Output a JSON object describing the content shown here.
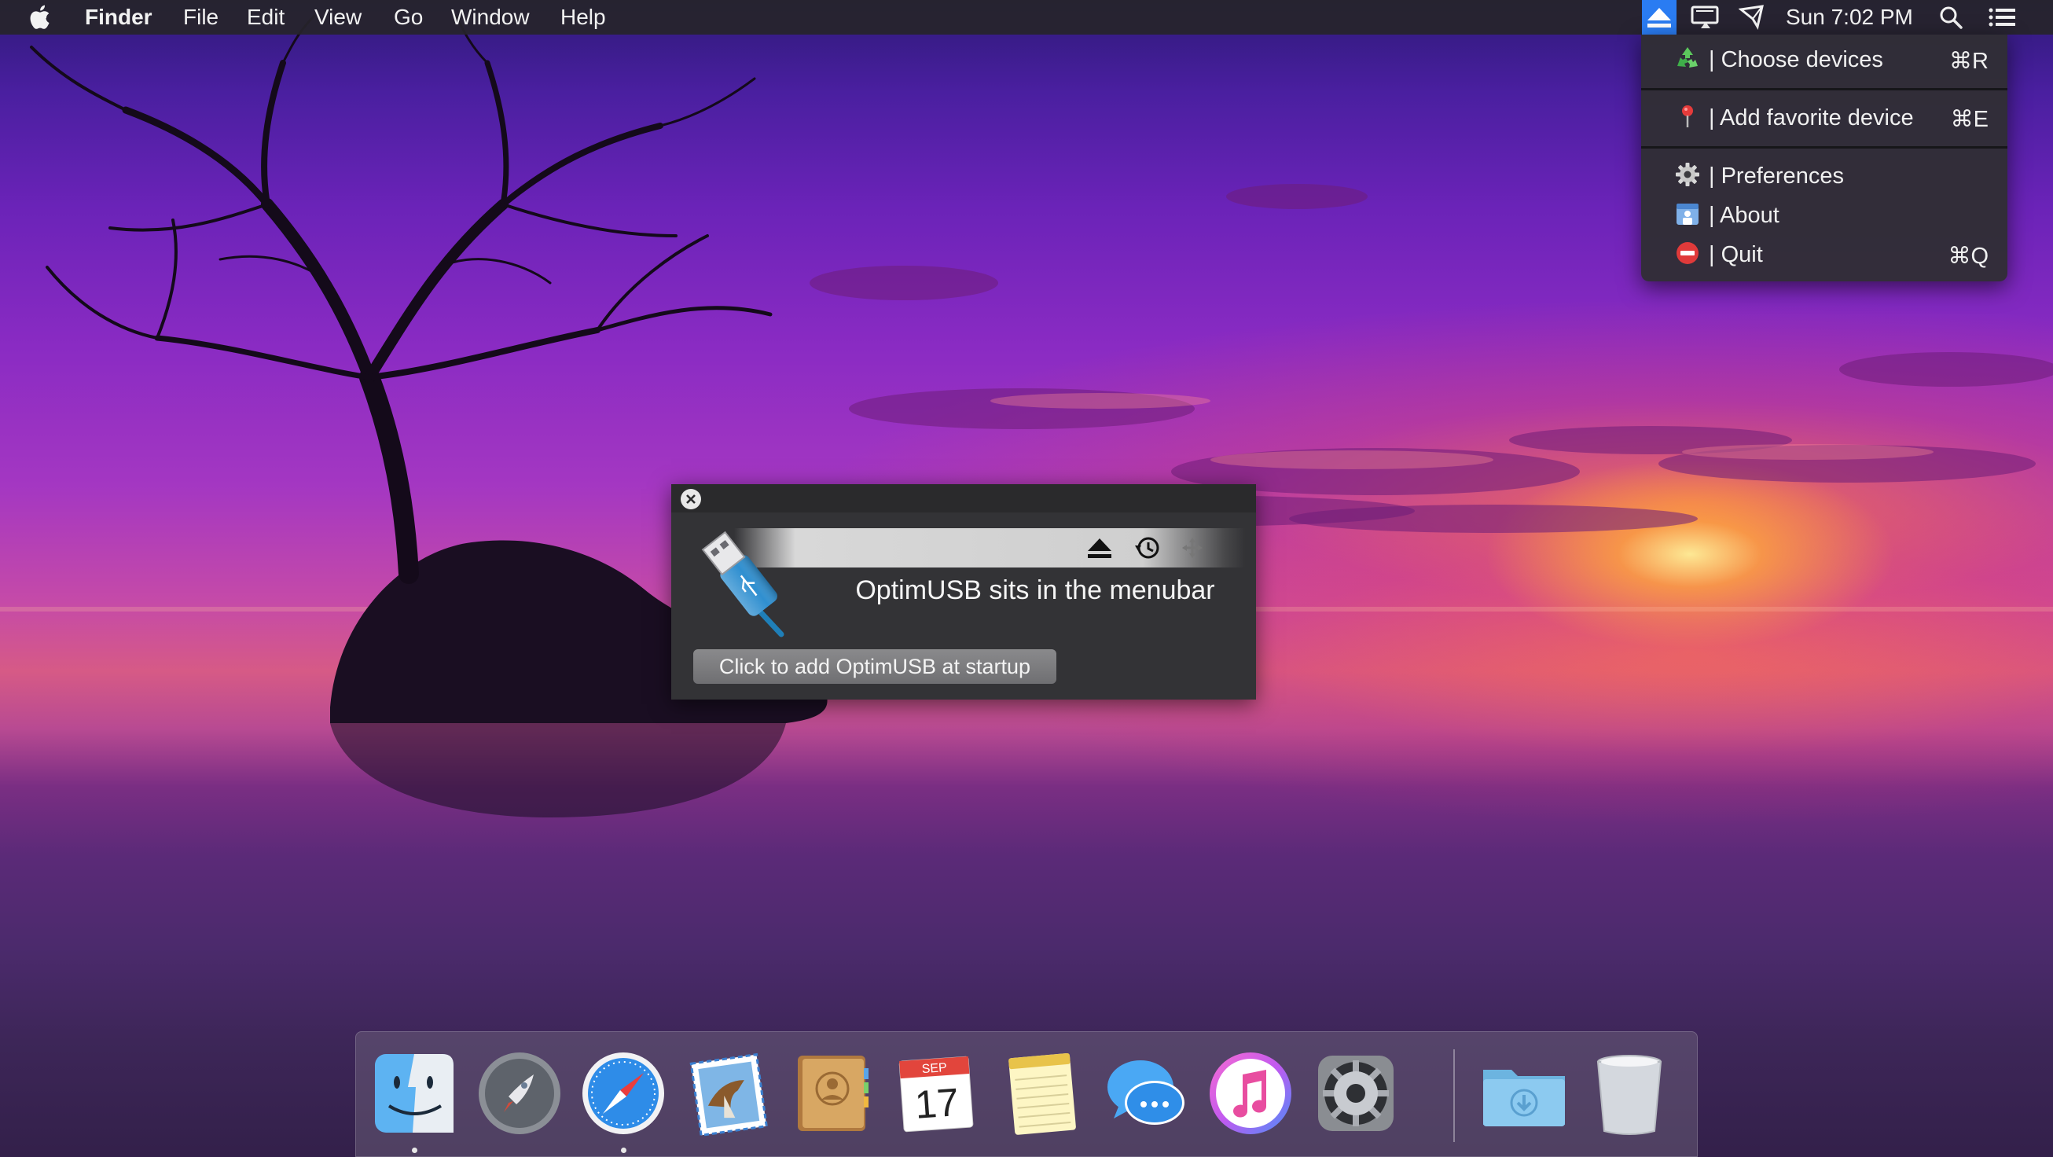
{
  "menubar": {
    "app_name": "Finder",
    "menus": [
      "File",
      "Edit",
      "View",
      "Go",
      "Window",
      "Help"
    ],
    "clock": "Sun 7:02 PM",
    "status_icons": [
      "optimusb-eject-icon",
      "display-icon",
      "airplay-icon",
      "spotlight-icon",
      "notification-center-icon"
    ]
  },
  "dropdown": {
    "items": [
      {
        "label": "| Choose devices",
        "shortcut": "⌘R",
        "icon": "recycle-icon"
      },
      {
        "label": "| Add favorite device",
        "shortcut": "⌘E",
        "icon": "pushpin-icon"
      },
      {
        "label": "| Preferences",
        "shortcut": "",
        "icon": "gear-icon"
      },
      {
        "label": "| About",
        "shortcut": "",
        "icon": "about-icon"
      },
      {
        "label": "| Quit",
        "shortcut": "⌘Q",
        "icon": "no-entry-icon"
      }
    ]
  },
  "popup": {
    "message": "OptimUSB sits in the menubar",
    "button_label": "Click to add OptimUSB at startup"
  },
  "dock": {
    "apps": [
      "finder",
      "launchpad",
      "safari",
      "mail",
      "contacts",
      "calendar",
      "notes",
      "messages",
      "itunes",
      "system-preferences",
      "downloads",
      "trash"
    ],
    "calendar_month": "SEP",
    "calendar_day": "17"
  },
  "colors": {
    "accent": "#2a7cf2",
    "menubar": "#262428",
    "menu_bg": "#302e34"
  }
}
